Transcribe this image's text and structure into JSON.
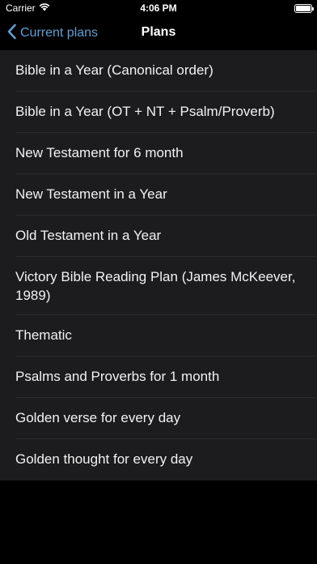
{
  "status_bar": {
    "carrier": "Carrier",
    "time": "4:06 PM"
  },
  "nav": {
    "back_label": "Current plans",
    "title": "Plans",
    "accent_color": "#5f9fd3"
  },
  "plans": [
    "Bible in a Year (Canonical order)",
    "Bible in a Year (OT + NT + Psalm/Proverb)",
    "New Testament for 6 month",
    "New Testament in a Year",
    "Old Testament in a Year",
    "Victory Bible Reading Plan (James McKeever, 1989)",
    "Thematic",
    "Psalms and Proverbs for 1 month",
    "Golden verse for every day",
    "Golden thought for every day"
  ]
}
